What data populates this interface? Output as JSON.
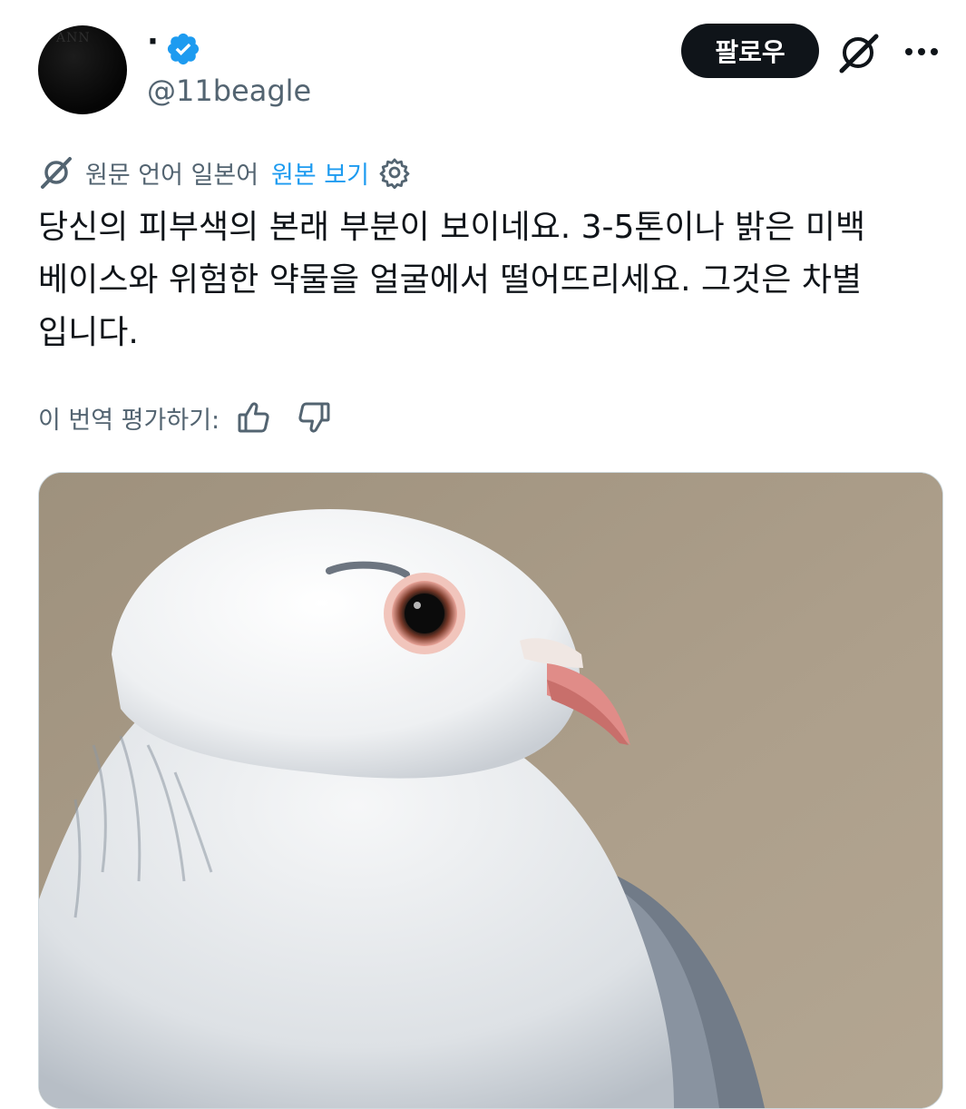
{
  "user": {
    "display_name": "·",
    "handle": "@11beagle",
    "verified": true,
    "avatar_icon": "avatar-image"
  },
  "actions": {
    "follow_label": "팔로우",
    "grok_icon": "grok-icon",
    "more_icon": "more-icon"
  },
  "translation": {
    "info": "원문 언어 일본어",
    "show_original": "원본 보기",
    "icon": "translate-icon",
    "settings_icon": "gear-icon"
  },
  "tweet": {
    "text": "당신의 피부색의 본래 부분이 보이네요. 3-5톤이나 밝은 미백\n베이스와 위험한 약물을 얼굴에서 떨어뜨리세요. 그것은 차별\n입니다."
  },
  "rating": {
    "label": "이 번역 평가하기:",
    "thumbs_up_icon": "thumbs-up-icon",
    "thumbs_down_icon": "thumbs-down-icon"
  },
  "media": {
    "alt_subject": "pigeon-photo"
  },
  "colors": {
    "text_primary": "#0f1419",
    "text_secondary": "#536471",
    "link": "#1d9bf0",
    "verified": "#1d9bf0",
    "follow_bg": "#0f1419",
    "photo_bg": "#a79a86"
  }
}
